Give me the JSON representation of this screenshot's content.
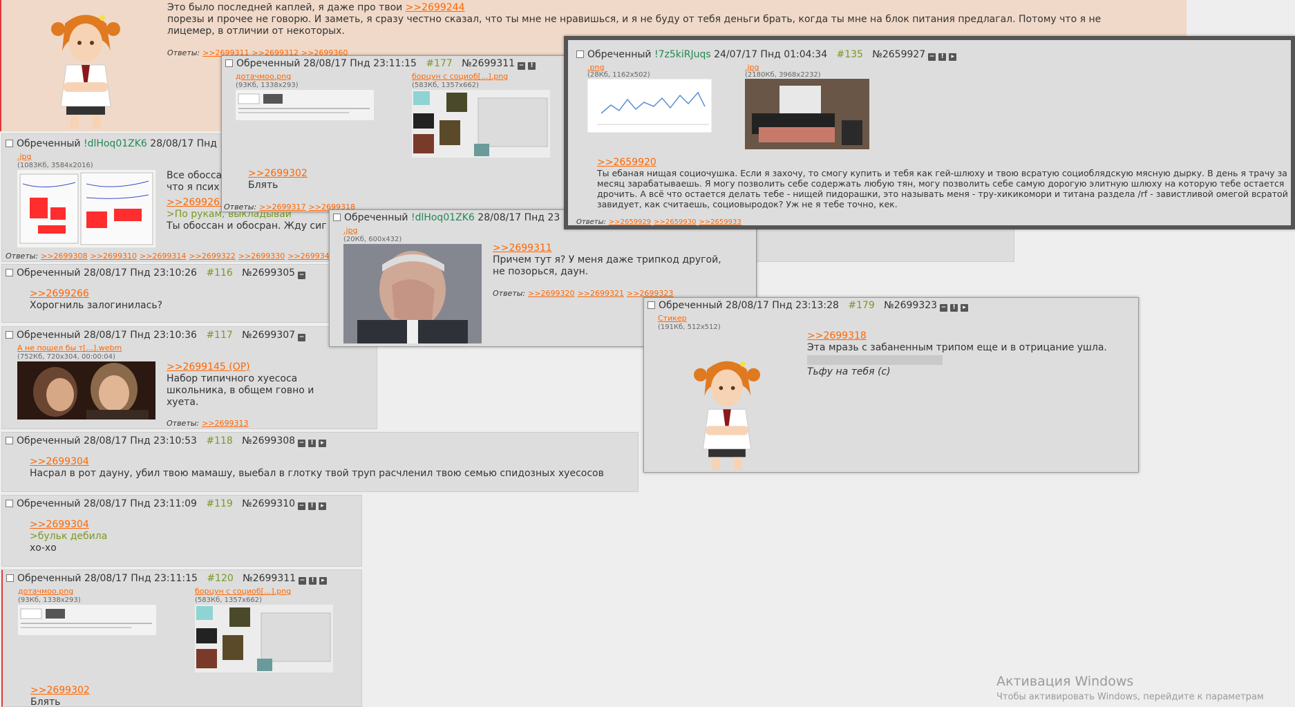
{
  "posts": {
    "op": {
      "text1_pre": "Это было последней каплей, я даже про твои ",
      "text1_link": ">>2699244",
      "text2": "порезы и прочее не говорю. И заметь, я сразу честно сказал, что ты мне не нравишься, и я не буду от тебя деньги брать, когда ты мне на блок питания предлагал. Потому что я не лицемер, в отличии от некоторых.",
      "replies_label": "Ответы:",
      "replies": [
        ">>2699311",
        ">>2699312",
        ">>2699360"
      ]
    },
    "p1": {
      "name": "Обреченный",
      "trip": "!dlHoq01ZK6",
      "date": "28/08/17 Пнд",
      "file": ".jpg",
      "info": "(1083Кб, 3584x2016)",
      "l1": "Все обосса",
      "l2": "что я псих",
      "link": ">>2699261",
      "quote": ">По рукам, выкладывай",
      "l3": "Ты обоссан и обосран. Жду сиг",
      "replies_label": "Ответы:",
      "replies": [
        ">>2699308",
        ">>2699310",
        ">>2699314",
        ">>2699322",
        ">>2699330",
        ">>2699345"
      ]
    },
    "p116": {
      "name": "Обреченный",
      "date": "28/08/17 Пнд 23:10:26",
      "num": "#116",
      "id": "№2699305",
      "link": ">>2699266",
      "text": "Хорогниль залогинилась?"
    },
    "p117": {
      "name": "Обреченный",
      "date": "28/08/17 Пнд 23:10:36",
      "num": "#117",
      "id": "№2699307",
      "file": "А не пошел бы т[...].webm",
      "info": "(752Кб, 720x304, 00:00:04)",
      "link": ">>2699145 (OP)",
      "text": "Набор типичного хуесоса школьника, в общем говно и хуета.",
      "replies_label": "Ответы:",
      "replies": [
        ">>2699313"
      ]
    },
    "p118": {
      "name": "Обреченный",
      "date": "28/08/17 Пнд 23:10:53",
      "num": "#118",
      "id": "№2699308",
      "link": ">>2699304",
      "text": "Насрал в рот дауну, убил твою мамашу, выебал в глотку твой труп расчленил твою семью спидозных хуесосов"
    },
    "p119": {
      "name": "Обреченный",
      "date": "28/08/17 Пнд 23:11:09",
      "num": "#119",
      "id": "№2699310",
      "link": ">>2699304",
      "quote": ">бульк дебила",
      "text": "хо-хо"
    },
    "p120": {
      "name": "Обреченный",
      "date": "28/08/17 Пнд 23:11:15",
      "num": "#120",
      "id": "№2699311",
      "file1": "дотачмоо.png",
      "info1": "(93Кб, 1338x293)",
      "file2": "борцун с социоб[...].png",
      "info2": "(583Кб, 1357x662)",
      "link": ">>2699302",
      "text": "Блять"
    },
    "prev177": {
      "name": "Обреченный",
      "date": "28/08/17 Пнд 23:11:15",
      "num": "#177",
      "id": "№2699311",
      "file1": "дотачмоо.png",
      "info1": "(93Кб, 1338x293)",
      "file2": "борцун с социоб[...].png",
      "info2": "(583Кб, 1357x662)",
      "link": ">>2699302",
      "text": "Блять",
      "replies_label": "Ответы:",
      "replies": [
        ">>2699317",
        ">>2699318"
      ]
    },
    "prevFace": {
      "name": "Обреченный",
      "trip": "!dlHoq01ZK6",
      "date": "28/08/17 Пнд 23",
      "file": ".jpg",
      "info": "(20Кб, 600x432)",
      "link": ">>2699311",
      "text": "Причем тут я? У меня даже трипкод другой, не позорься, даун.",
      "replies_label": "Ответы:",
      "replies": [
        ">>2699320",
        ">>2699321",
        ">>2699323"
      ]
    },
    "prev135": {
      "name": "Обреченный",
      "trip": "!7z5kiRJuqs",
      "date": "24/07/17 Пнд 01:04:34",
      "num": "#135",
      "id": "№2659927",
      "file1": ".png",
      "info1": "(28Кб, 1162x502)",
      "file2": ".jpg",
      "info2": "(2180Кб, 3968x2232)",
      "link": ">>2659920",
      "text": "Ты ебаная нищая социочушка. Если я захочу, то смогу купить и тебя как гей-шлюху и твою всратую социоблядскую мясную дырку. В день я трачу за месяц зарабатываешь. Я могу позволить себе содержать любую тян, могу позволить себе самую дорогую элитную шлюху на которую тебе остается дрочить. А всё что остается делать тебе - нищей пидорашки, это называть меня - тру-хикикомори и титана раздела /rf - завистливой омегой всратой завидует, как считаешь, социовыродок? Уж не я тебе точно, кек.",
      "replies_label": "Ответы:",
      "replies": [
        ">>2659929",
        ">>2659930",
        ">>2659933"
      ]
    },
    "prev179": {
      "name": "Обреченный",
      "date": "28/08/17 Пнд 23:13:28",
      "num": "#179",
      "id": "№2699323",
      "file": "Стикер",
      "info": "(191Кб, 512x512)",
      "link": ">>2699318",
      "text": "Эта мразь с забаненным трипом еще и в отрицание ушла.",
      "text2": "Тьфу на тебя (с)"
    }
  },
  "windows": {
    "title": "Активация Windows",
    "subtitle": "Чтобы активировать Windows, перейдите к параметрам"
  }
}
